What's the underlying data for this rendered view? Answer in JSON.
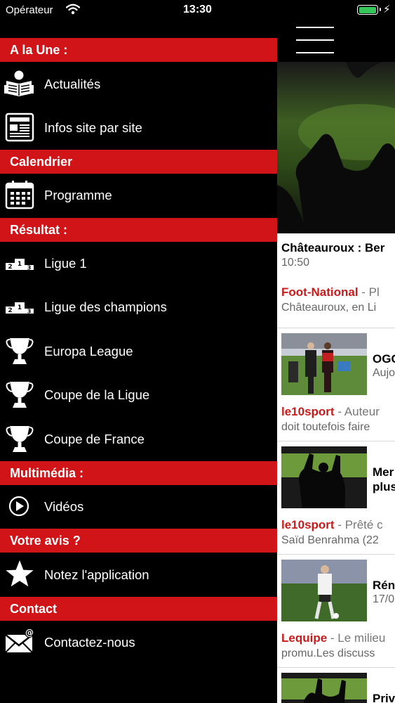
{
  "status_bar": {
    "carrier": "Opérateur",
    "time": "13:30",
    "battery_level": 1.0
  },
  "menu": {
    "sections": [
      {
        "header": "A la Une :",
        "items": [
          {
            "label": "Actualités",
            "icon": "newspaper-reader-icon"
          },
          {
            "label": "Infos site par site",
            "icon": "newspaper-icon"
          }
        ]
      },
      {
        "header": "Calendrier",
        "items": [
          {
            "label": "Programme",
            "icon": "calendar-icon"
          }
        ]
      },
      {
        "header": "Résultat :",
        "items": [
          {
            "label": "Ligue 1",
            "icon": "podium-icon"
          },
          {
            "label": "Ligue des champions",
            "icon": "podium-icon"
          },
          {
            "label": "Europa League",
            "icon": "trophy-icon"
          },
          {
            "label": "Coupe de la Ligue",
            "icon": "trophy-icon"
          },
          {
            "label": "Coupe de France",
            "icon": "trophy-icon"
          }
        ]
      },
      {
        "header": "Multimédia :",
        "items": [
          {
            "label": "Vidéos",
            "icon": "play-icon"
          }
        ]
      },
      {
        "header": "Votre avis ?",
        "items": [
          {
            "label": "Notez l'application",
            "icon": "star-icon"
          }
        ]
      },
      {
        "header": "Contact",
        "items": [
          {
            "label": "Contactez-nous",
            "icon": "mail-icon"
          }
        ]
      }
    ]
  },
  "content": {
    "featured": {
      "title": "Châteauroux : Ber",
      "time": "10:50",
      "source": "Foot-National",
      "desc_a": "- Pl",
      "desc_b": "Châteauroux, en Li"
    },
    "articles": [
      {
        "title_a": "OGC",
        "title_b": "Aujo",
        "source": "le10sport",
        "desc_a": "- Auteur",
        "desc_b": "doit toutefois faire"
      },
      {
        "title_a": "Mer",
        "title_b": "plus",
        "source": "le10sport",
        "desc_a": "- Prêté c",
        "desc_b": "Saïd Benrahma (22"
      },
      {
        "title_a": "Rén",
        "title_b": "17/0",
        "source": "Lequipe",
        "desc_a": "- Le milieu",
        "desc_b": "promu.Les discuss"
      },
      {
        "title_a": "Priv"
      }
    ]
  },
  "colors": {
    "section_header": "#d01418",
    "source": "#c81c1c",
    "battery": "#35c759"
  }
}
